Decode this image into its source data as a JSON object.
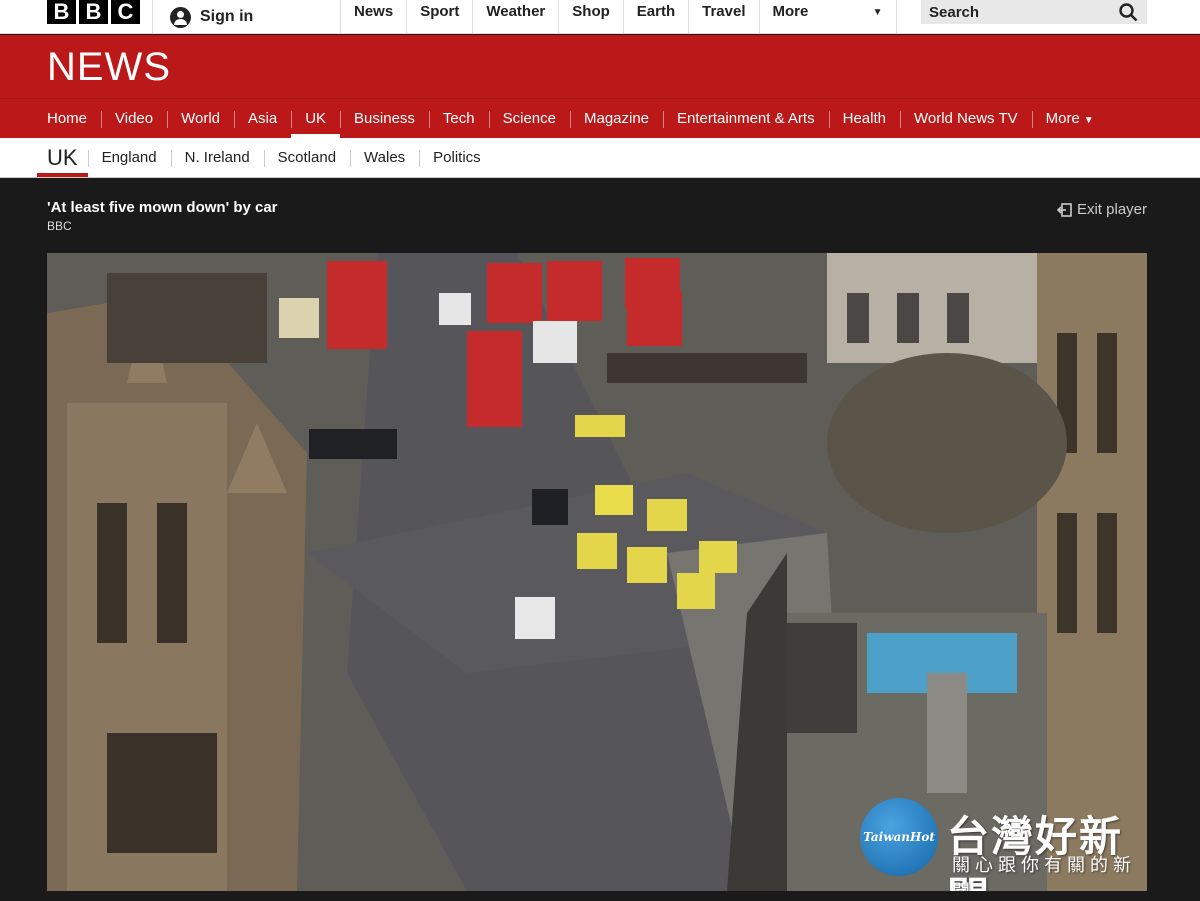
{
  "top_bar": {
    "logo_letters": [
      "B",
      "B",
      "C"
    ],
    "sign_in_label": "Sign in",
    "nav_items": [
      "News",
      "Sport",
      "Weather",
      "Shop",
      "Earth",
      "Travel"
    ],
    "more_label": "More",
    "search_placeholder": "Search"
  },
  "banner": {
    "title": "NEWS",
    "color": "#bb1919"
  },
  "main_nav": {
    "items": [
      "Home",
      "Video",
      "World",
      "Asia",
      "UK",
      "Business",
      "Tech",
      "Science",
      "Magazine",
      "Entertainment & Arts",
      "Health",
      "World News TV"
    ],
    "active": "UK",
    "more_label": "More"
  },
  "sub_nav": {
    "section": "UK",
    "items": [
      "England",
      "N. Ireland",
      "Scotland",
      "Wales",
      "Politics"
    ]
  },
  "player": {
    "title": "'At least five mown down' by car",
    "source": "BBC",
    "exit_label": "Exit player"
  },
  "watermark": {
    "logo_text": "TaiwanHot",
    "name": "台灣好新聞",
    "tagline": "關心跟你有關的新聞"
  },
  "icons": {
    "search": "search-icon",
    "exit": "exit-icon",
    "user": "user-icon"
  }
}
